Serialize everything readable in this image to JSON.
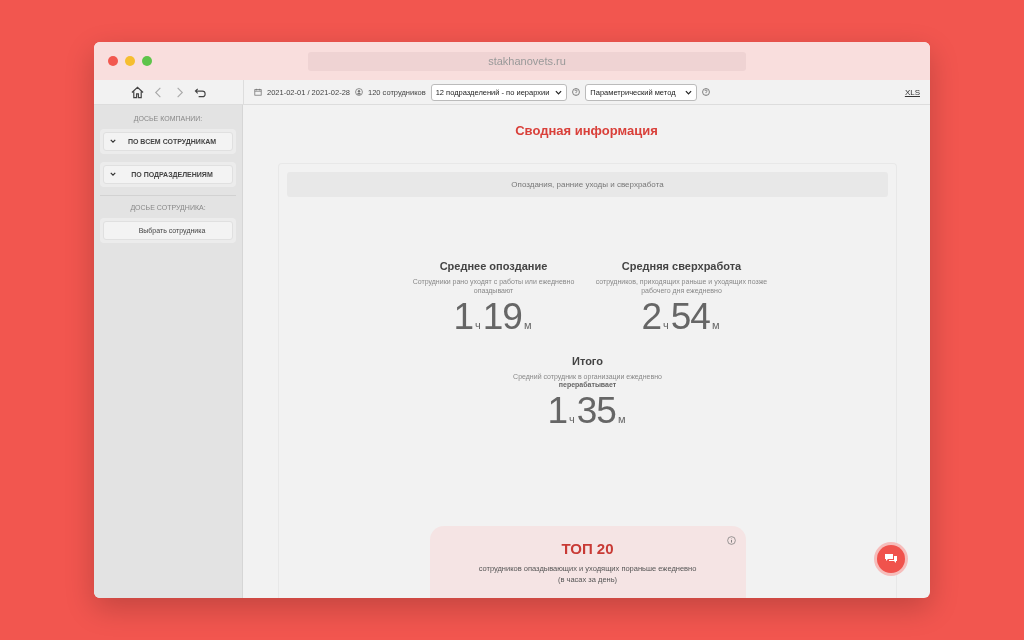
{
  "browser": {
    "url": "stakhanovets.ru"
  },
  "toolbar": {
    "period": "2021-02-01 / 2021-02-28",
    "employees": "120 сотрудников",
    "department_select": "12 подразделений - по иерархии",
    "method_select": "Параметрический метод",
    "export_link": "XLS"
  },
  "sidebar": {
    "sections": [
      {
        "label": "ДОСЬЕ КОМПАНИИ:",
        "items": [
          {
            "label": "ПО ВСЕМ СОТРУДНИКАМ",
            "kind": "accordion",
            "expanded": false
          },
          {
            "label": "ПО ПОДРАЗДЕЛЕНИЯМ",
            "kind": "accordion",
            "expanded": false
          }
        ]
      },
      {
        "label": "ДОСЬЕ СОТРУДНИКА:",
        "items": [
          {
            "label": "Выбрать сотрудника",
            "kind": "button"
          }
        ]
      }
    ]
  },
  "page": {
    "title": "Сводная информация",
    "card": {
      "header": "Опоздания, ранние уходы и сверхработа",
      "metrics": [
        {
          "title": "Среднее опоздание",
          "description": "Сотрудники рано уходят с работы или ежедневно опаздывают",
          "hours": "1",
          "hours_unit": "ч",
          "minutes": "19",
          "minutes_unit": "м"
        },
        {
          "title": "Средняя сверхработа",
          "description": "сотрудников, приходящих раньше и уходящих позже рабочего дня ежедневно",
          "hours": "2",
          "hours_unit": "ч",
          "minutes": "54",
          "minutes_unit": "м"
        }
      ],
      "total": {
        "title": "Итого",
        "description": "Средний сотрудник в организации ежедневно\n**перерабатывает**",
        "hours": "1",
        "hours_unit": "ч",
        "minutes": "35",
        "minutes_unit": "м"
      },
      "top": {
        "title": "ТОП 20",
        "description": "сотрудников опаздывающих и уходящих пораньше ежедневно",
        "note": "(в часах за день)"
      }
    }
  }
}
